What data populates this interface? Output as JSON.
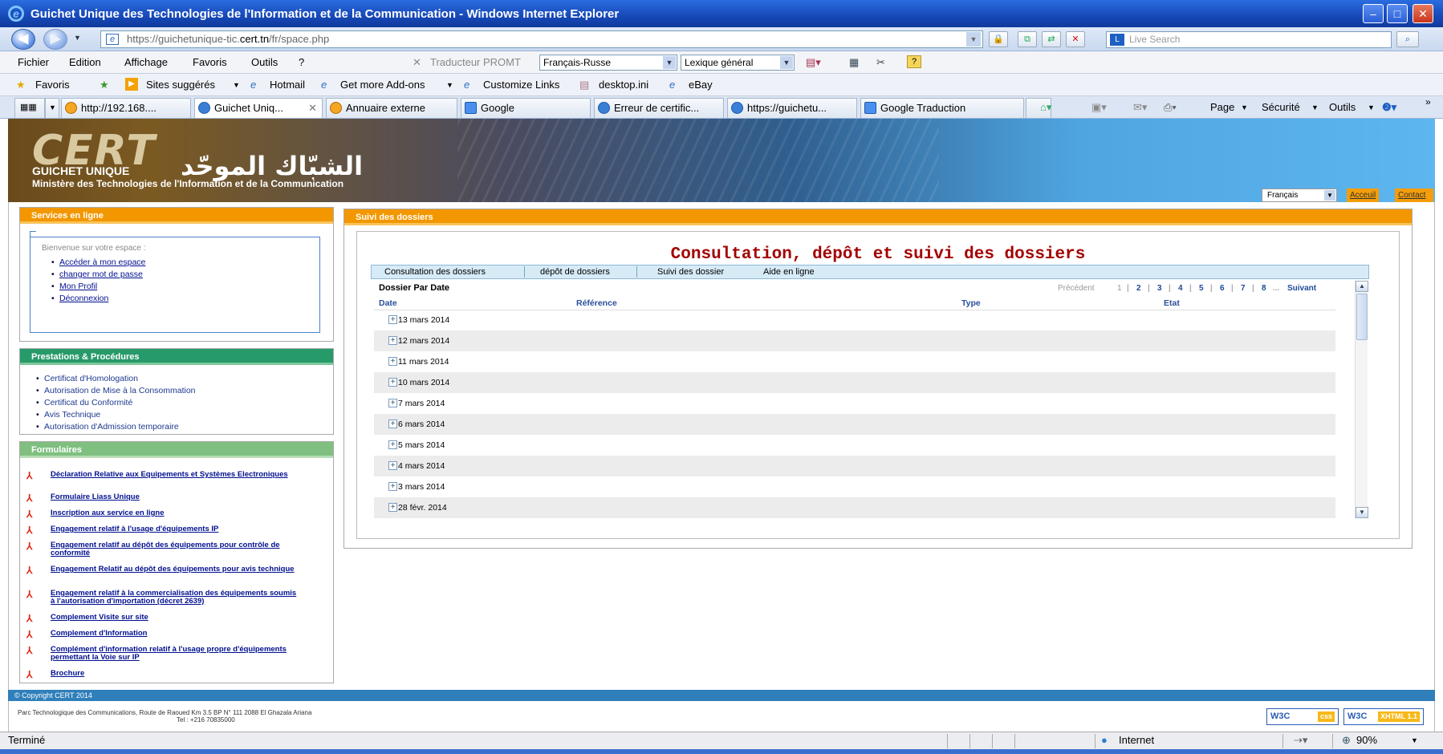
{
  "window": {
    "title": "Guichet Unique des Technologies de l'Information et de la Communication - Windows Internet Explorer",
    "min": "–",
    "max": "□",
    "close": "✕"
  },
  "address": {
    "prefix": "https://guichetunique-tic.",
    "host": "cert.tn",
    "path": "/fr/space.php",
    "live_search": "Live Search"
  },
  "menu": {
    "items": [
      "Fichier",
      "Edition",
      "Affichage",
      "Favoris",
      "Outils",
      "?"
    ],
    "translator_label": "Traducteur PROMT",
    "translator_lang": "Français-Russe",
    "translator_lexicon": "Lexique général"
  },
  "favorites": {
    "favoris": "Favoris",
    "items": [
      "Sites suggérés",
      "Hotmail",
      "Get more Add-ons",
      "Customize Links",
      "desktop.ini",
      "eBay"
    ]
  },
  "tabs": [
    {
      "label": "http://192.168...."
    },
    {
      "label": "Guichet Uniq..."
    },
    {
      "label": "Annuaire externe"
    },
    {
      "label": "Google"
    },
    {
      "label": "Erreur de certific..."
    },
    {
      "label": "https://guichetu..."
    },
    {
      "label": "Google Traduction"
    }
  ],
  "commands": {
    "page": "Page",
    "securite": "Sécurité",
    "outils": "Outils"
  },
  "banner": {
    "logo": "CERT",
    "guichet": "GUICHET UNIQUE",
    "arabic": "الشبّاك الموحّد",
    "ministere": "Ministère des Technologies de l'Information et de la Communication",
    "lang": "Français",
    "accueil": "Acceuil",
    "contact": "Contact"
  },
  "services": {
    "title": "Services en ligne",
    "welcome": "Bienvenue sur votre espace :",
    "links": [
      "Accéder à mon espace",
      "changer mot de passe",
      "Mon Profil",
      "Déconnexion"
    ]
  },
  "prestations": {
    "title": "Prestations & Procédures",
    "items": [
      "Certificat d'Homologation",
      "Autorisation de Mise à la Consommation",
      "Certificat du Conformité",
      "Avis Technique",
      "Autorisation d'Admission temporaire"
    ]
  },
  "formulaires": {
    "title": "Formulaires",
    "items": [
      "Déclaration Relative aux Equipements et Systèmes Electroniques",
      "Formulaire Liass Unique",
      "Inscription aux service en ligne",
      "Engagement relatif à l'usage d'équipements IP",
      "Engagement relatif au dépôt des équipements pour contrôle de conformité",
      "Engagement Relatif au dépôt des équipements pour avis technique",
      "Engagement relatif à la commercialisation des équipements soumis à l'autorisation d'importation (décret 2639)",
      "Complement Visite sur site",
      "Complement d'Information",
      "Complément d'information relatif à l'usage propre d'équipements permettant la Voie sur IP",
      "Brochure"
    ]
  },
  "main": {
    "panel_title": "Suivi des dossiers",
    "big_title": "Consultation, dépôt et suivi des dossiers",
    "subtabs": [
      "Consultation des dossiers",
      "dépôt de dossiers",
      "Suivi des dossier",
      "Aide en ligne"
    ],
    "section_title": "Dossier Par Date",
    "pager": {
      "prev": "Précédent",
      "pages": [
        "1",
        "2",
        "3",
        "4",
        "5",
        "6",
        "7",
        "8"
      ],
      "ellipsis": "...",
      "next": "Suivant"
    },
    "columns": [
      "Date",
      "Référence",
      "Type",
      "Etat"
    ],
    "rows": [
      "13 mars 2014",
      "12 mars 2014",
      "11 mars 2014",
      "10 mars 2014",
      "7 mars 2014",
      "6 mars 2014",
      "5 mars 2014",
      "4 mars 2014",
      "3 mars 2014",
      "28 févr. 2014"
    ]
  },
  "footer": {
    "copyright": "© Copyright CERT 2014",
    "address": "Parc Technologique des Communications, Route de Raoued Km 3.5 BP N° 111 2088 El Ghazala Ariana",
    "tel": "Tel : +216 70835000",
    "w3c_css": "W3C",
    "css": "css",
    "w3c_xhtml": "W3C",
    "xhtml": "XHTML 1.1"
  },
  "status": {
    "text": "Terminé",
    "zone": "Internet",
    "zoom": "90%"
  }
}
